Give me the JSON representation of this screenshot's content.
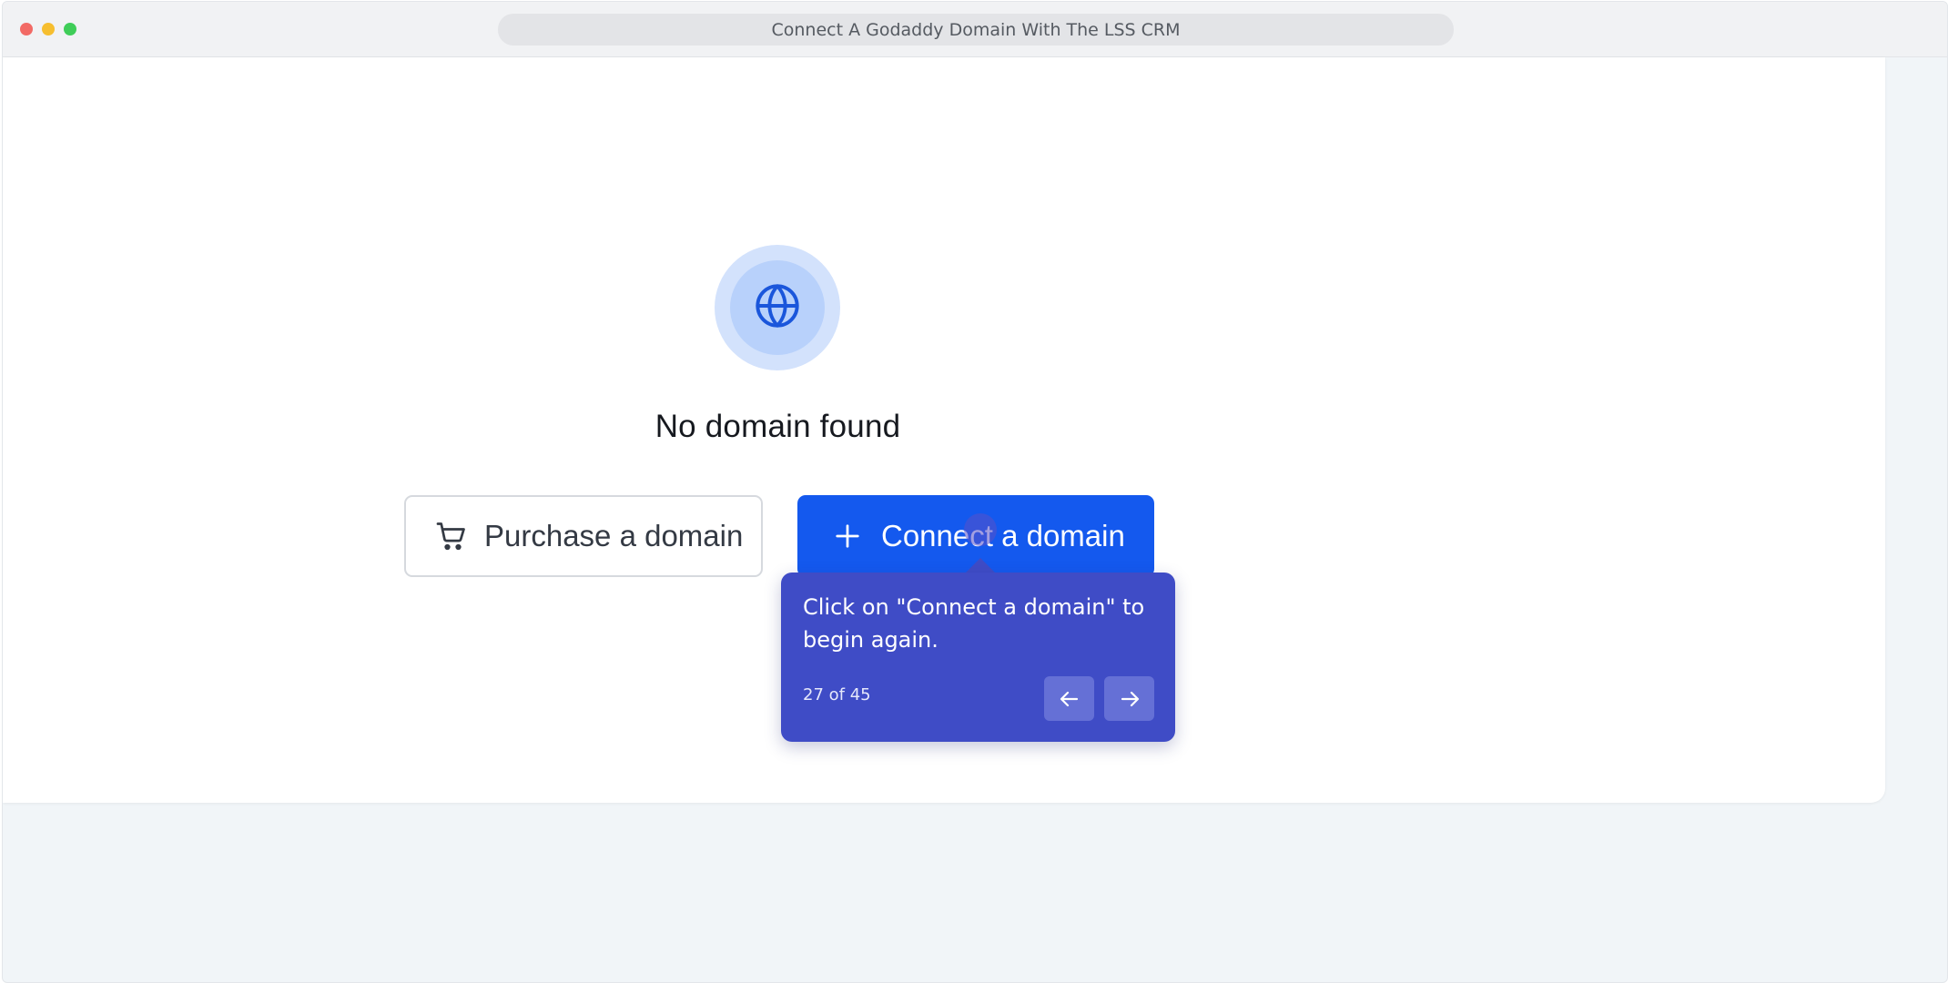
{
  "window": {
    "title": "Connect A Godaddy Domain With The LSS CRM"
  },
  "empty_state": {
    "icon": "globe-icon",
    "heading": "No domain found"
  },
  "actions": {
    "purchase_label": "Purchase a domain",
    "purchase_icon": "cart-icon",
    "connect_label": "Connect a domain",
    "connect_icon": "plus-icon"
  },
  "tooltip": {
    "text": "Click on \"Connect a domain\" to begin again.",
    "step": "27 of 45",
    "prev_icon": "arrow-left-icon",
    "next_icon": "arrow-right-icon"
  },
  "colors": {
    "primary": "#1459ee",
    "tooltip_bg": "#3f4cc6",
    "globe_ring": "#d3e2fc"
  }
}
